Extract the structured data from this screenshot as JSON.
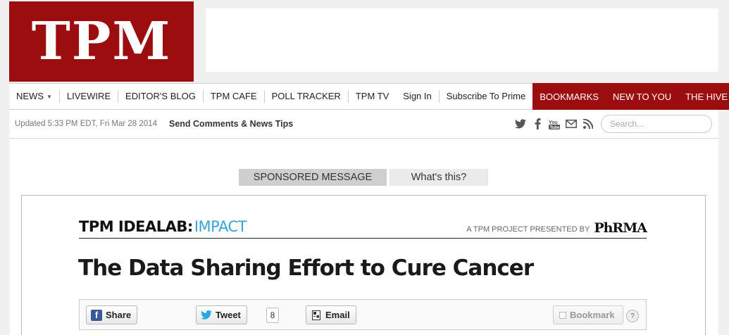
{
  "logo": {
    "text": "TPM",
    "color": "#9b0d0f"
  },
  "nav": {
    "left": [
      {
        "label": "NEWS",
        "has_caret": true
      },
      {
        "label": "LIVEWIRE"
      },
      {
        "label": "EDITOR'S BLOG"
      },
      {
        "label": "TPM CAFE"
      },
      {
        "label": "POLL TRACKER"
      },
      {
        "label": "TPM TV"
      }
    ],
    "right": [
      {
        "label": "Sign In"
      },
      {
        "label": "Subscribe To Prime"
      }
    ],
    "red": [
      {
        "label": "BOOKMARKS"
      },
      {
        "label": "NEW TO YOU"
      },
      {
        "label": "THE HIVE"
      }
    ]
  },
  "subbar": {
    "updated": "Updated 5:33 PM EDT, Fri Mar 28 2014",
    "tips": "Send Comments & News Tips",
    "social_icons": [
      "twitter-icon",
      "facebook-icon",
      "youtube-icon",
      "email-icon",
      "rss-icon"
    ],
    "search_placeholder": "Search..."
  },
  "sponsored": {
    "label": "SPONSORED MESSAGE",
    "whats_this": "What's this?"
  },
  "idealab": {
    "prefix": "TPM IDEALAB:",
    "section": "IMPACT",
    "presented_by": "A TPM PROJECT PRESENTED BY",
    "sponsor": "PhRMA",
    "accent": "#37a4d3"
  },
  "article": {
    "headline": "The Data Sharing Effort to Cure Cancer"
  },
  "share": {
    "facebook": "Share",
    "tweet": "Tweet",
    "tweet_count": "8",
    "email": "Email",
    "bookmark": "Bookmark",
    "help": "?"
  }
}
